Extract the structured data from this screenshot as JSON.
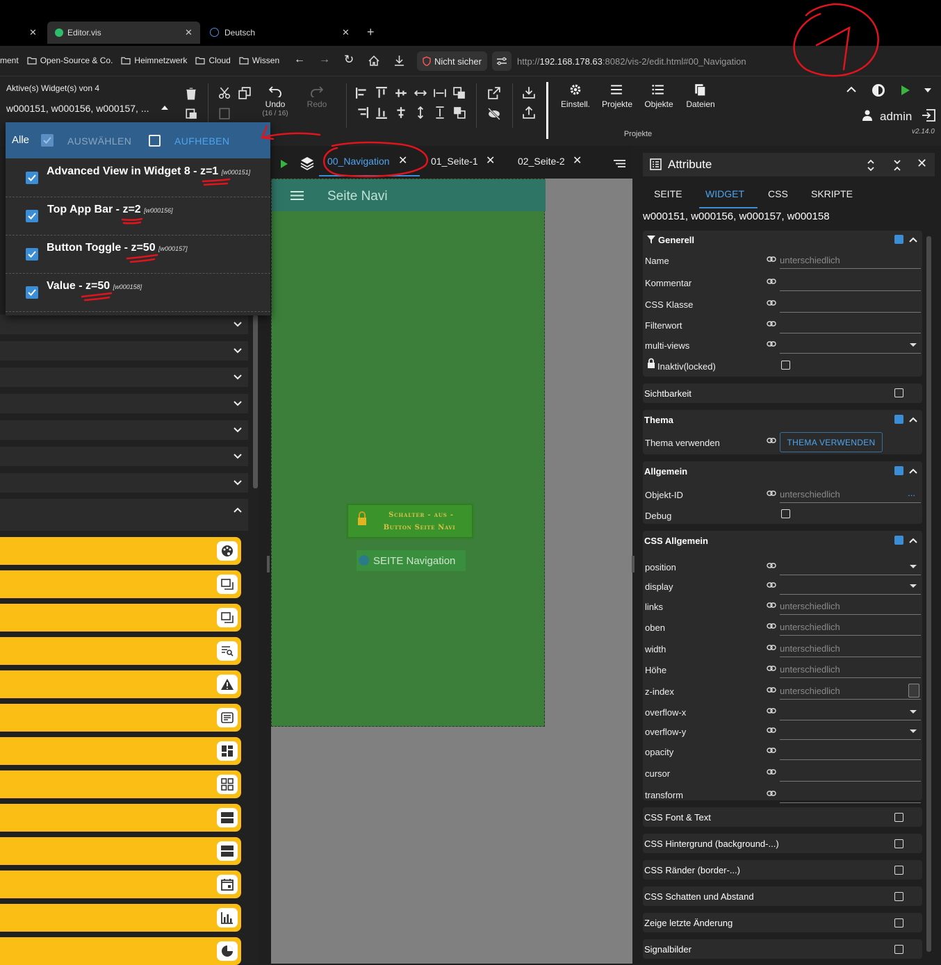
{
  "browser": {
    "tabs": [
      {
        "label": ""
      },
      {
        "label": "Editor.vis"
      },
      {
        "label": "Deutsch"
      }
    ],
    "bookmarks": [
      "ment",
      "Open-Source & Co.",
      "Heimnetzwerk",
      "Cloud",
      "Wissen"
    ],
    "security": "Nicht sicher",
    "url_prefix": "http://",
    "url_host": "192.168.178.63",
    "url_rest": ":8082/vis-2/edit.html#00_Navigation"
  },
  "toolbar": {
    "active_label": "Aktive(s) Widget(s) von 4",
    "active_value": "w000151, w000156, w000157, ...",
    "undo": "Undo",
    "undo_count": "(16 / 16)",
    "redo": "Redo",
    "menu": [
      "Einstell.",
      "Projekte",
      "Objekte",
      "Dateien"
    ],
    "group_label": "Projekte",
    "user": "admin",
    "version": "v2.14.0"
  },
  "dropdown": {
    "all": "Alle",
    "select": "AUSWÄHLEN",
    "deselect": "AUFHEBEN",
    "items": [
      {
        "name": "Advanced View in Widget 8",
        "z": "z=1",
        "id": "[w000151]"
      },
      {
        "name": "Top App Bar",
        "z": "z=2",
        "id": "[w000156]"
      },
      {
        "name": "Button Toggle",
        "z": "z=50",
        "id": "[w000157]"
      },
      {
        "name": "Value",
        "z": "z=50",
        "id": "[w000158]"
      }
    ]
  },
  "views": {
    "tabs": [
      "00_Navigation",
      "01_Seite-1",
      "02_Seite-2"
    ],
    "app_bar_title": "Seite Navi",
    "button_text_1": "Schalter - aus -",
    "button_text_2": "Button Seite Navi",
    "value_text": "SEITE Navigation"
  },
  "attributes": {
    "title": "Attribute",
    "tabs": [
      "SEITE",
      "WIDGET",
      "CSS",
      "SKRIPTE"
    ],
    "active_tab": "WIDGET",
    "widget_ids": "w000151, w000156, w000157, w000158",
    "generell": {
      "title": "Generell",
      "name_label": "Name",
      "name_value": "unterschiedlich",
      "kommentar": "Kommentar",
      "css_klasse": "CSS Klasse",
      "filterwort": "Filterwort",
      "multi_views": "multi-views",
      "inaktiv": "Inaktiv(locked)"
    },
    "sichtbarkeit": "Sichtbarkeit",
    "thema": {
      "title": "Thema",
      "label": "Thema verwenden",
      "button": "THEMA VERWENDEN"
    },
    "allgemein": {
      "title": "Allgemein",
      "objekt_id": "Objekt-ID",
      "objekt_value": "unterschiedlich",
      "objekt_dots": "...",
      "debug": "Debug"
    },
    "css_allgemein": {
      "title": "CSS Allgemein",
      "rows": [
        {
          "label": "position",
          "value": ""
        },
        {
          "label": "display",
          "value": ""
        },
        {
          "label": "links",
          "value": "unterschiedlich"
        },
        {
          "label": "oben",
          "value": "unterschiedlich"
        },
        {
          "label": "width",
          "value": "unterschiedlich"
        },
        {
          "label": "Höhe",
          "value": "unterschiedlich"
        },
        {
          "label": "z-index",
          "value": "unterschiedlich"
        },
        {
          "label": "overflow-x",
          "value": ""
        },
        {
          "label": "overflow-y",
          "value": ""
        },
        {
          "label": "opacity",
          "value": ""
        },
        {
          "label": "cursor",
          "value": ""
        },
        {
          "label": "transform",
          "value": ""
        }
      ]
    },
    "collapsed": [
      "CSS Font & Text",
      "CSS Hintergrund (background-...)",
      "CSS Ränder (border-...)",
      "CSS Schatten und Abstand",
      "Zeige letzte Änderung",
      "Signalbilder"
    ]
  },
  "colors": {
    "accent": "#3b8dd6",
    "view_bg": "#3b7f3b",
    "app_bar": "#2f7566",
    "widget_yellow": "#fbbe14",
    "annotation_red": "#e0141c"
  },
  "left_widget_icons": [
    "palette-icon",
    "window-icon",
    "window-icon",
    "search-list-icon",
    "warning-icon",
    "text-box-icon",
    "dashboard-icon",
    "grid-icon",
    "rows-icon",
    "rows-icon",
    "calendar-icon",
    "bar-chart-icon",
    "pie-chart-icon"
  ]
}
